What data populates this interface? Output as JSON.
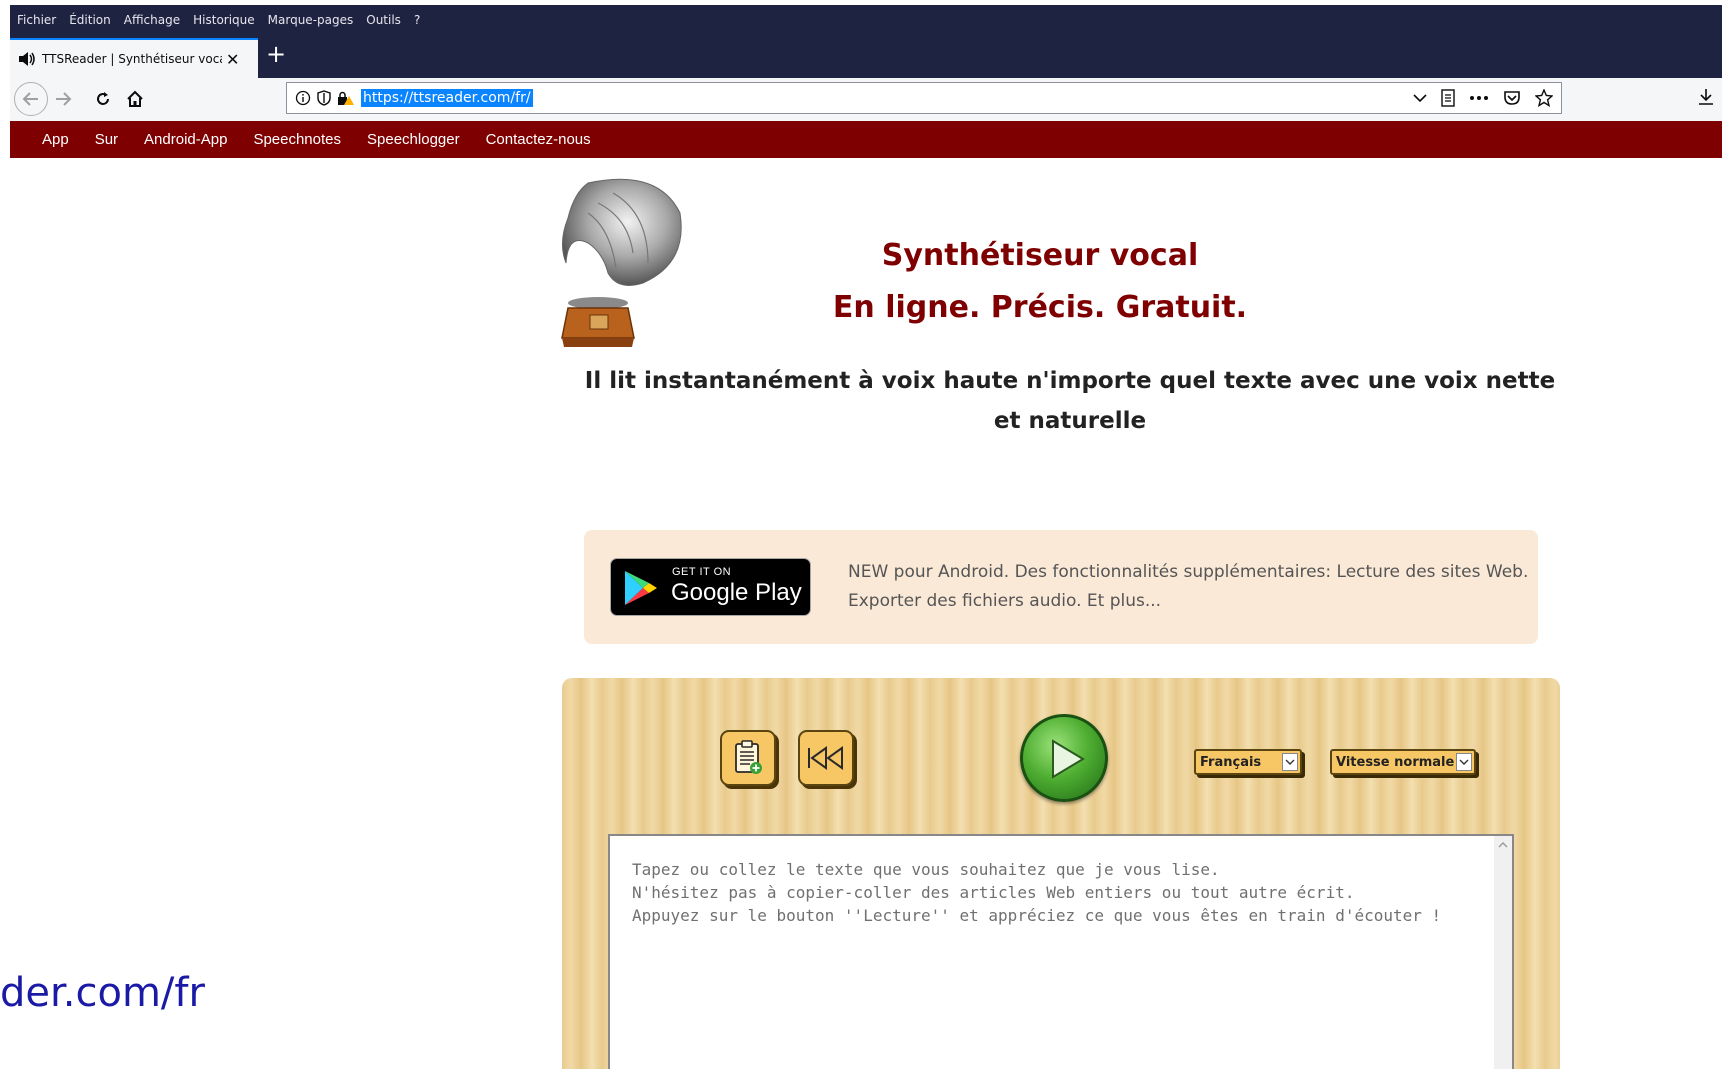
{
  "menu": [
    "Fichier",
    "Édition",
    "Affichage",
    "Historique",
    "Marque-pages",
    "Outils",
    "?"
  ],
  "tab": {
    "title": "TTSReader | Synthétiseur vocal",
    "close": "✕",
    "new": "+"
  },
  "nav": {
    "url": "https://ttsreader.com/fr/"
  },
  "sitenav": [
    "App",
    "Sur",
    "Android-App",
    "Speechnotes",
    "Speechlogger",
    "Contactez-nous"
  ],
  "header": {
    "line1": "Synthétiseur vocal",
    "line2": "En ligne. Précis. Gratuit."
  },
  "subtitle": "Il lit instantanément à voix haute n'importe quel texte avec une voix nette et naturelle",
  "promo": {
    "badge_small": "GET IT ON",
    "badge_big": "Google Play",
    "text": "NEW pour Android. Des fonctionnalités supplémentaires: Lecture des sites Web. Exporter des fichiers audio. Et plus..."
  },
  "player": {
    "language": "Français",
    "speed": "Vitesse normale",
    "placeholder": "Tapez ou collez le texte que vous souhaitez que je vous lise.\nN'hésitez pas à copier-coller des articles Web entiers ou tout autre écrit.\nAppuyez sur le bouton ''Lecture'' et appréciez ce que vous êtes en train d'écouter !"
  },
  "status_link": "der.com/fr",
  "colors": {
    "menubar": "#1f2342",
    "sitenav": "#7f0000",
    "heading": "#7f0000",
    "promo_bg": "#fbe9d8",
    "url_highlight": "#0a84ff"
  }
}
